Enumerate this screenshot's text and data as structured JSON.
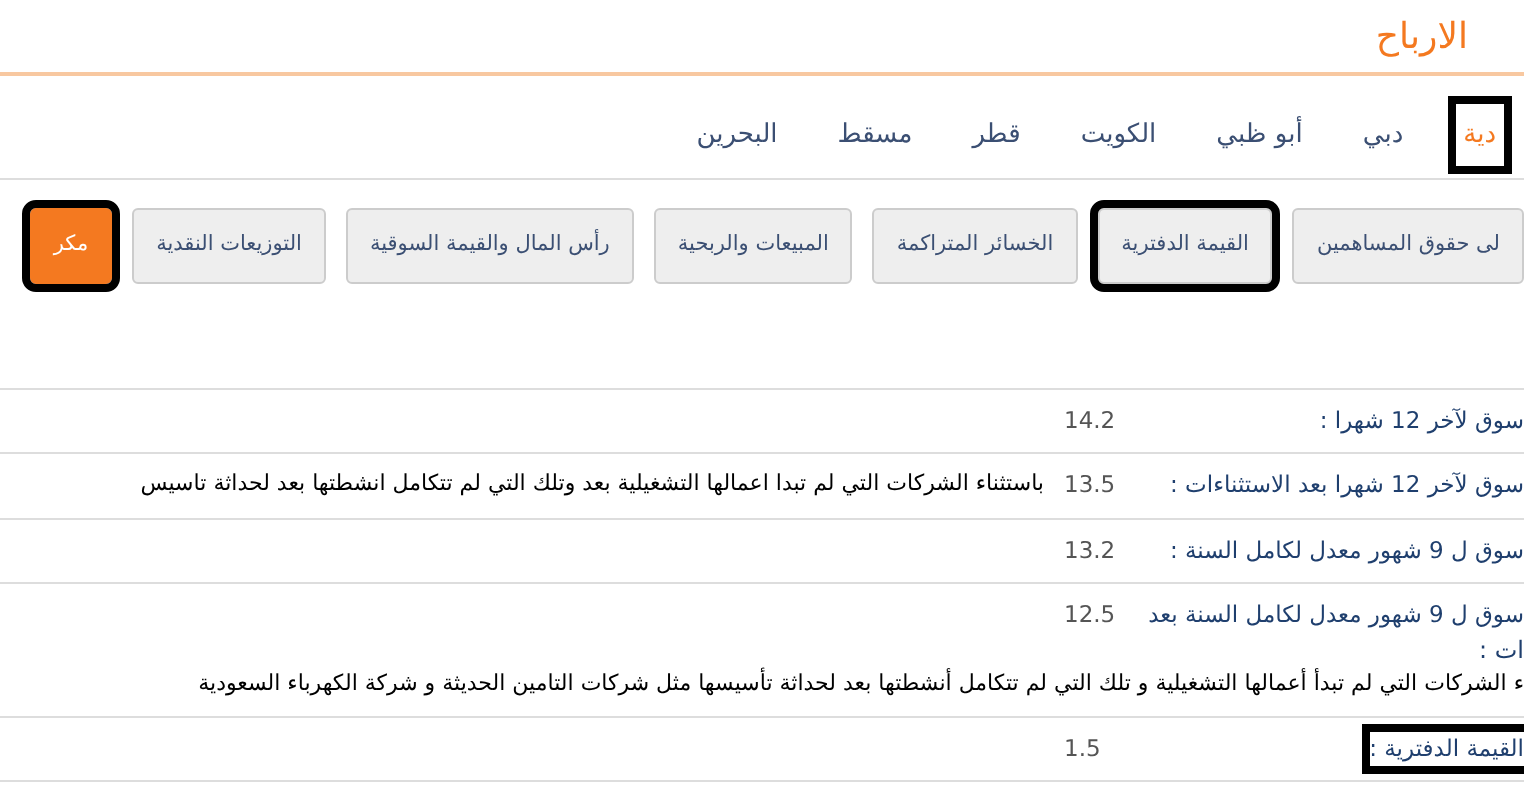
{
  "title": "الارباح",
  "tabs": [
    {
      "label": "دية",
      "selected": true,
      "highlighted": true
    },
    {
      "label": "دبي",
      "selected": false,
      "highlighted": false
    },
    {
      "label": "أبو ظبي",
      "selected": false,
      "highlighted": false
    },
    {
      "label": "الكويت",
      "selected": false,
      "highlighted": false
    },
    {
      "label": "قطر",
      "selected": false,
      "highlighted": false
    },
    {
      "label": "مسقط",
      "selected": false,
      "highlighted": false
    },
    {
      "label": "البحرين",
      "selected": false,
      "highlighted": false
    }
  ],
  "buttons": [
    {
      "label": "لى حقوق المساهمين",
      "selected": false,
      "highlighted": false
    },
    {
      "label": "القيمة الدفترية",
      "selected": false,
      "highlighted": true
    },
    {
      "label": "الخسائر المتراكمة",
      "selected": false,
      "highlighted": false
    },
    {
      "label": "المبيعات والربحية",
      "selected": false,
      "highlighted": false
    },
    {
      "label": "رأس المال والقيمة السوقية",
      "selected": false,
      "highlighted": false
    },
    {
      "label": "التوزيعات النقدية",
      "selected": false,
      "highlighted": false
    },
    {
      "label": "مكر",
      "selected": true,
      "highlighted": true
    }
  ],
  "rows": [
    {
      "label": "سوق لآخر 12 شهرا :",
      "value": "14.2",
      "highlighted": false
    },
    {
      "label": "سوق لآخر 12 شهرا بعد الاستثناءات :",
      "value": "13.5",
      "note": "باستثناء الشركات التي لم تبدا اعمالها التشغيلية بعد وتلك التي لم تتكامل انشطتها بعد لحداثة تاسيس",
      "highlighted": false
    },
    {
      "label": "سوق ل 9 شهور معدل لكامل السنة :",
      "value": "13.2",
      "highlighted": false
    },
    {
      "label": "سوق ل 9 شهور معدل لكامل السنة بعد",
      "label_2": "ات :",
      "value": "12.5",
      "wide_note": "ء الشركات التي لم تبدأ أعمالها التشغيلية و تلك التي لم تتكامل أنشطتها بعد لحداثة تأسيسها مثل شركات التامين الحديثة و شركة الكهرباء السعودية",
      "highlighted": false
    },
    {
      "label": "القيمة الدفترية :",
      "value": "1.5",
      "highlighted": true
    }
  ]
}
